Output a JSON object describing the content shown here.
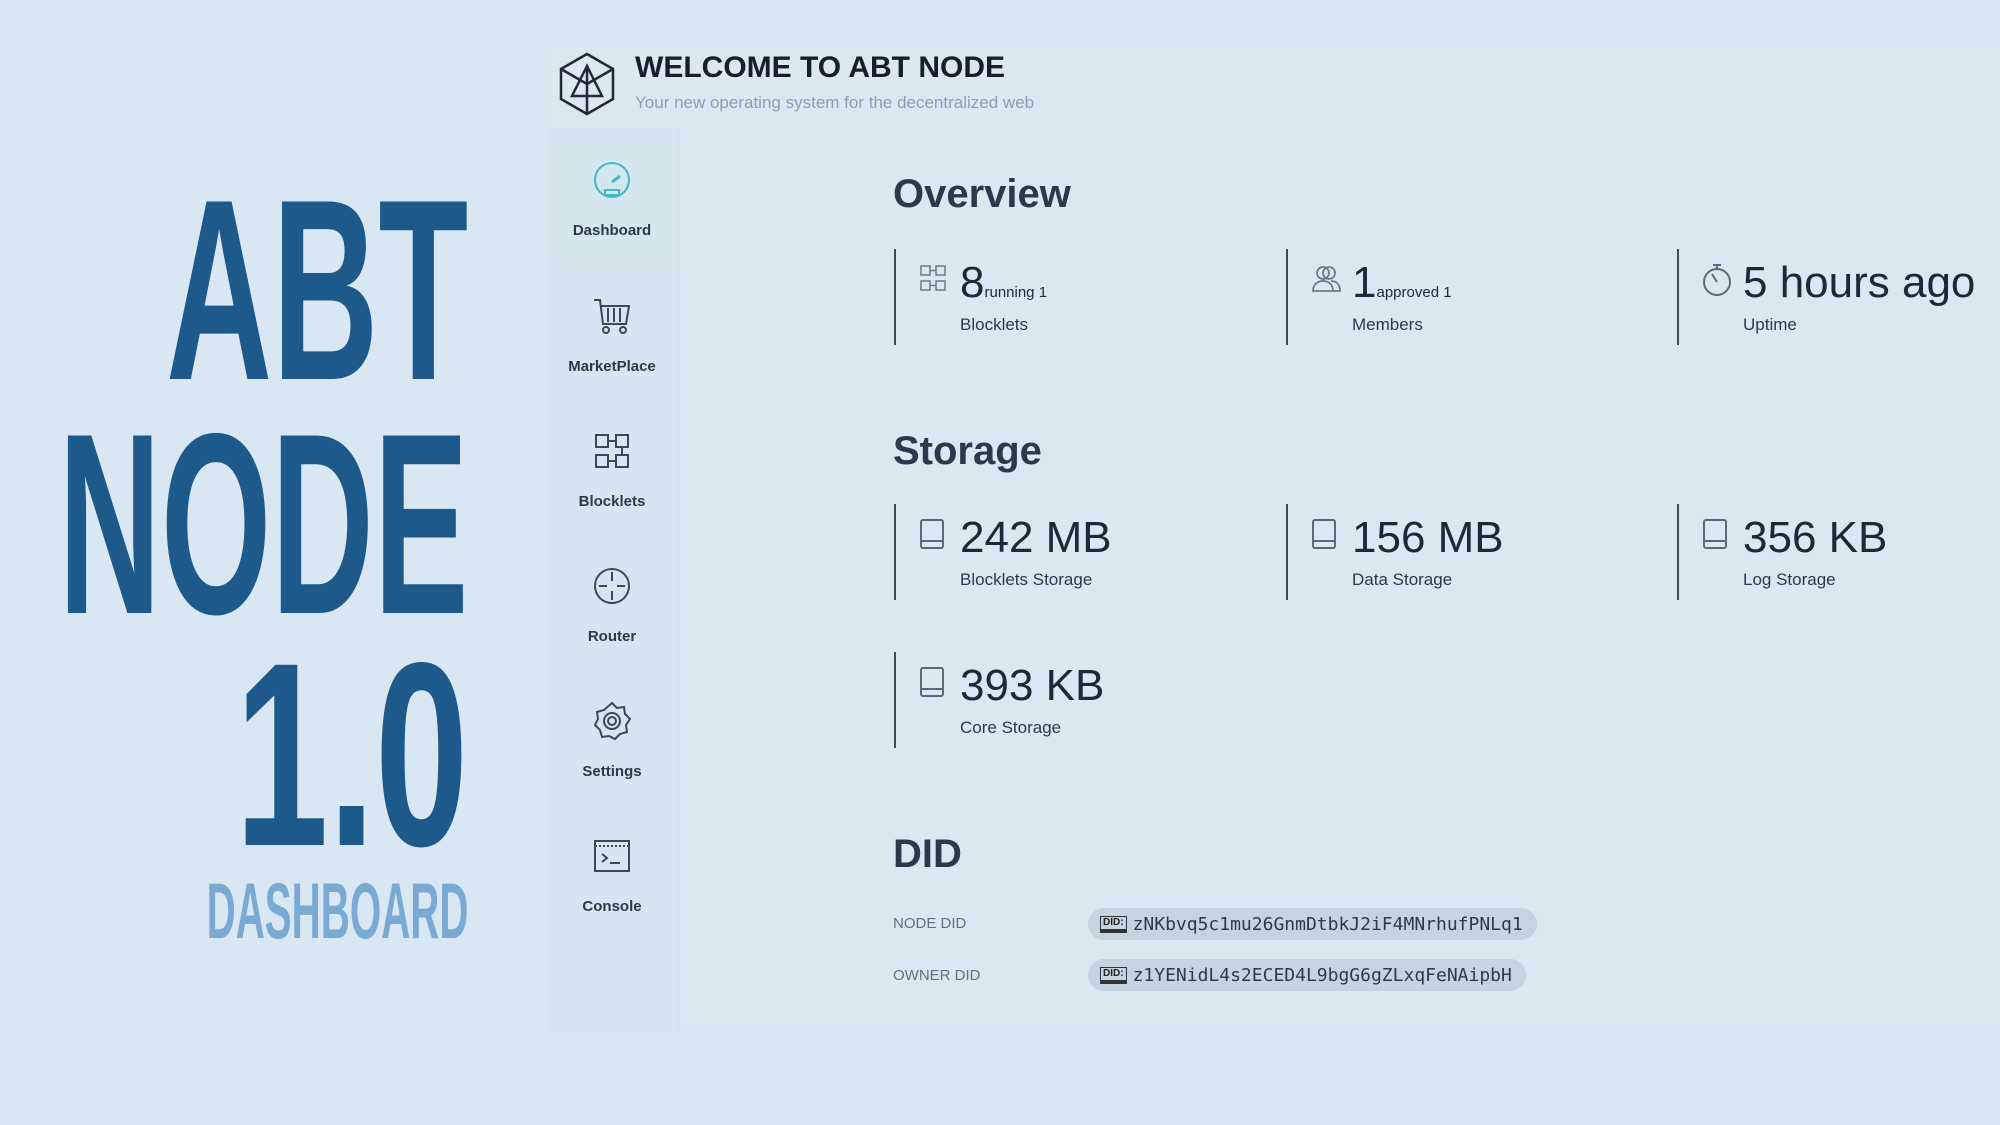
{
  "hero": {
    "line1": "ABT",
    "line2": "NODE",
    "line3": "1.0",
    "subtitle": "DASHBOARD"
  },
  "header": {
    "title": "WELCOME TO ABT NODE",
    "subtitle": "Your new operating system for the decentralized web"
  },
  "sidebar": {
    "items": [
      {
        "label": "Dashboard",
        "icon": "speedometer-icon",
        "active": true
      },
      {
        "label": "MarketPlace",
        "icon": "cart-icon"
      },
      {
        "label": "Blocklets",
        "icon": "blocks-icon"
      },
      {
        "label": "Router",
        "icon": "router-icon"
      },
      {
        "label": "Settings",
        "icon": "gear-icon"
      },
      {
        "label": "Console",
        "icon": "terminal-icon"
      }
    ]
  },
  "overview": {
    "title": "Overview",
    "stats": [
      {
        "value": "8",
        "sub": "running 1",
        "label": "Blocklets",
        "icon": "blocks-icon"
      },
      {
        "value": "1",
        "sub": "approved 1",
        "label": "Members",
        "icon": "members-icon"
      },
      {
        "value": "5 hours ago",
        "sub": "",
        "label": "Uptime",
        "icon": "stopwatch-icon"
      }
    ]
  },
  "storage": {
    "title": "Storage",
    "items": [
      {
        "value": "242 MB",
        "label": "Blocklets Storage"
      },
      {
        "value": "156 MB",
        "label": "Data Storage"
      },
      {
        "value": "356 KB",
        "label": "Log Storage"
      },
      {
        "value": "393 KB",
        "label": "Core Storage"
      }
    ]
  },
  "did": {
    "title": "DID",
    "badge": "DID:",
    "node_label": "NODE DID",
    "node_value": "zNKbvq5c1mu26GnmDtbkJ2iF4MNrhufPNLq1",
    "owner_label": "OWNER DID",
    "owner_value": "z1YENidL4s2ECED4L9bgG6gZLxqFeNAipbH"
  },
  "colors": {
    "hero": "#1d5a8b",
    "hero_sub": "#7aaad4",
    "accent": "#3fb8c8",
    "background": "#d8e7f2"
  }
}
